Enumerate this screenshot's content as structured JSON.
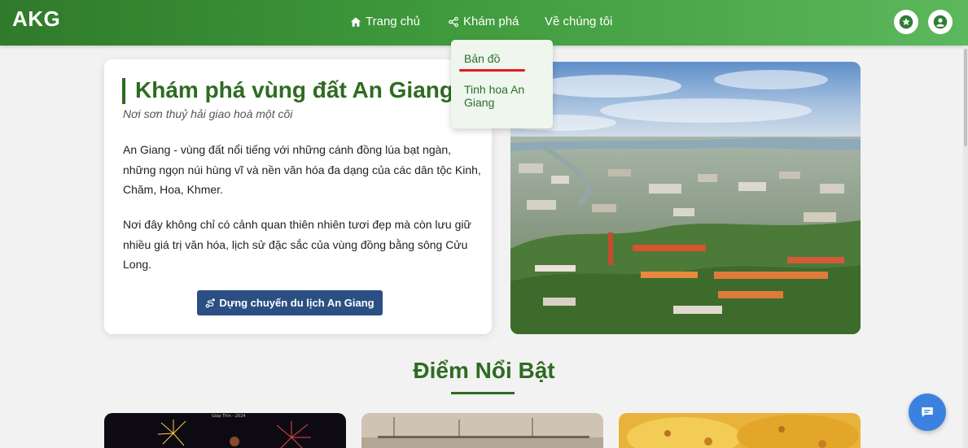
{
  "header": {
    "logo": "AKG",
    "nav": [
      {
        "label": "Trang chủ",
        "icon": "home-icon"
      },
      {
        "label": "Khám phá",
        "icon": "share-icon"
      },
      {
        "label": "Về chúng tôi"
      }
    ],
    "actions": [
      {
        "icon": "star-icon"
      },
      {
        "icon": "user-icon"
      }
    ]
  },
  "dropdown": {
    "items": [
      {
        "label": "Bản đồ",
        "active": true
      },
      {
        "label": "Tinh hoa An Giang"
      }
    ],
    "active_color": "#e31b1b"
  },
  "hero": {
    "title": "Khám phá vùng đất An Giang",
    "subtitle": "Nơi sơn thuỷ hải giao hoà một cõi",
    "paragraphs": [
      "An Giang - vùng đất nổi tiếng với những cánh đồng lúa bạt ngàn, những ngọn núi hùng vĩ và nền văn hóa đa dạng của các dân tộc Kinh, Chăm, Hoa, Khmer.",
      "Nơi đây không chỉ có cảnh quan thiên nhiên tươi đẹp mà còn lưu giữ nhiều giá trị văn hóa, lịch sử đặc sắc của vùng đồng bằng sông Cửu Long."
    ],
    "button_label": "Dựng chuyến du lịch An Giang",
    "button_icon": "route-icon"
  },
  "highlights": {
    "title": "Điểm Nổi Bật",
    "cards": [
      {
        "image": "fireworks-image",
        "caption": "Giáp Thìn - 2024"
      },
      {
        "image": "historic-harbor-image"
      },
      {
        "image": "banh-xeo-image"
      }
    ]
  },
  "chat": {
    "icon": "chat-icon"
  },
  "colors": {
    "brand_green": "#2e6b22",
    "navbar_start": "#2f7a2b",
    "navbar_end": "#5cb85c",
    "button_blue": "#2b4f82",
    "chat_blue": "#3b82e0"
  }
}
